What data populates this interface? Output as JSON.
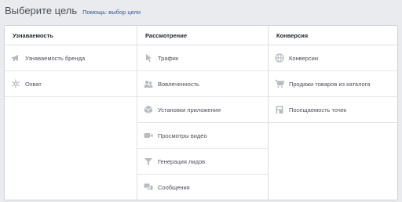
{
  "header": {
    "title": "Выберите цель",
    "help_link": "Помощь: выбор цели"
  },
  "columns": [
    {
      "heading": "Узнаваемость",
      "items": [
        {
          "label": "Узнаваемость бренда",
          "icon": "megaphone-icon"
        },
        {
          "label": "Охват",
          "icon": "snowflake-icon"
        }
      ]
    },
    {
      "heading": "Рассмотрение",
      "items": [
        {
          "label": "Трафик",
          "icon": "cursor-icon"
        },
        {
          "label": "Вовлеченность",
          "icon": "people-icon"
        },
        {
          "label": "Установки приложения",
          "icon": "cube-icon"
        },
        {
          "label": "Просмотры видео",
          "icon": "video-camera-icon"
        },
        {
          "label": "Генерация лидов",
          "icon": "funnel-icon"
        },
        {
          "label": "Сообщения",
          "icon": "chat-bubbles-icon"
        }
      ]
    },
    {
      "heading": "Конверсия",
      "items": [
        {
          "label": "Конверсии",
          "icon": "globe-icon"
        },
        {
          "label": "Продажи товаров из каталога",
          "icon": "cart-icon"
        },
        {
          "label": "Посещаемость точек",
          "icon": "store-icon"
        }
      ]
    }
  ],
  "colors": {
    "icon": "#b7bbc2",
    "link": "#365899",
    "text": "#4b4f56",
    "border": "#dddfe2",
    "background": "#e9ebee"
  }
}
